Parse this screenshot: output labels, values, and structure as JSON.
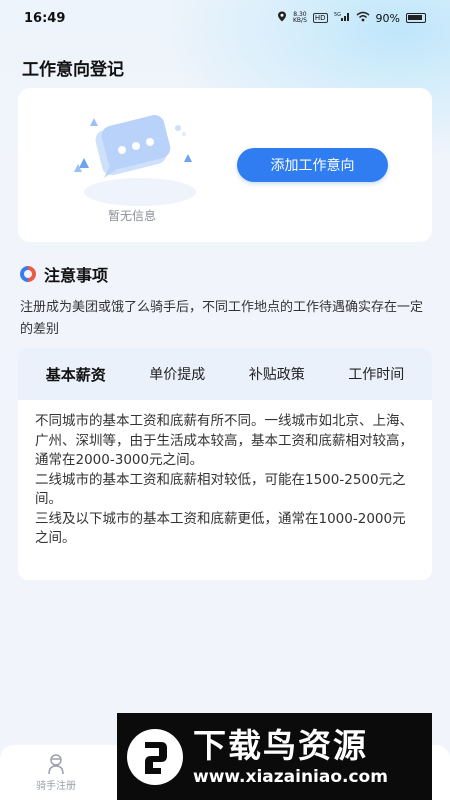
{
  "status_bar": {
    "time": "16:49",
    "net_speed_value": "8.30",
    "net_speed_unit": "KB/S",
    "hd_badge": "HD",
    "signal_label": "5G",
    "battery": "90%",
    "icons": [
      "location-icon",
      "hd-icon",
      "signal-icon",
      "wifi-icon",
      "battery-icon"
    ]
  },
  "page": {
    "title": "工作意向登记"
  },
  "intent_card": {
    "empty_text": "暂无信息",
    "add_button_label": "添加工作意向"
  },
  "notice": {
    "title": "注意事项",
    "description": "注册成为美团或饿了么骑手后，不同工作地点的工作待遇确实存在一定的差别",
    "tabs": [
      {
        "label": "基本薪资",
        "active": true
      },
      {
        "label": "单价提成",
        "active": false
      },
      {
        "label": "补贴政策",
        "active": false
      },
      {
        "label": "工作时间",
        "active": false
      }
    ],
    "content": [
      "不同城市的基本工资和底薪有所不同。一线城市如北京、上海、广州、深圳等，由于生活成本较高，基本工资和底薪相对较高，通常在2000-3000元之间。",
      "二线城市的基本工资和底薪相对较低，可能在1500-2500元之间。",
      "三线及以下城市的基本工资和底薪更低，通常在1000-2000元之间。"
    ]
  },
  "bottom_nav": {
    "items": [
      {
        "label": "骑手注册",
        "icon": "rider-icon"
      }
    ]
  },
  "watermark": {
    "title": "下载鸟资源",
    "url": "www.xiazainiao.com"
  },
  "colors": {
    "accent": "#2f7df0",
    "background": "#f1f4fb",
    "tab_bar": "#eaf1fb"
  }
}
